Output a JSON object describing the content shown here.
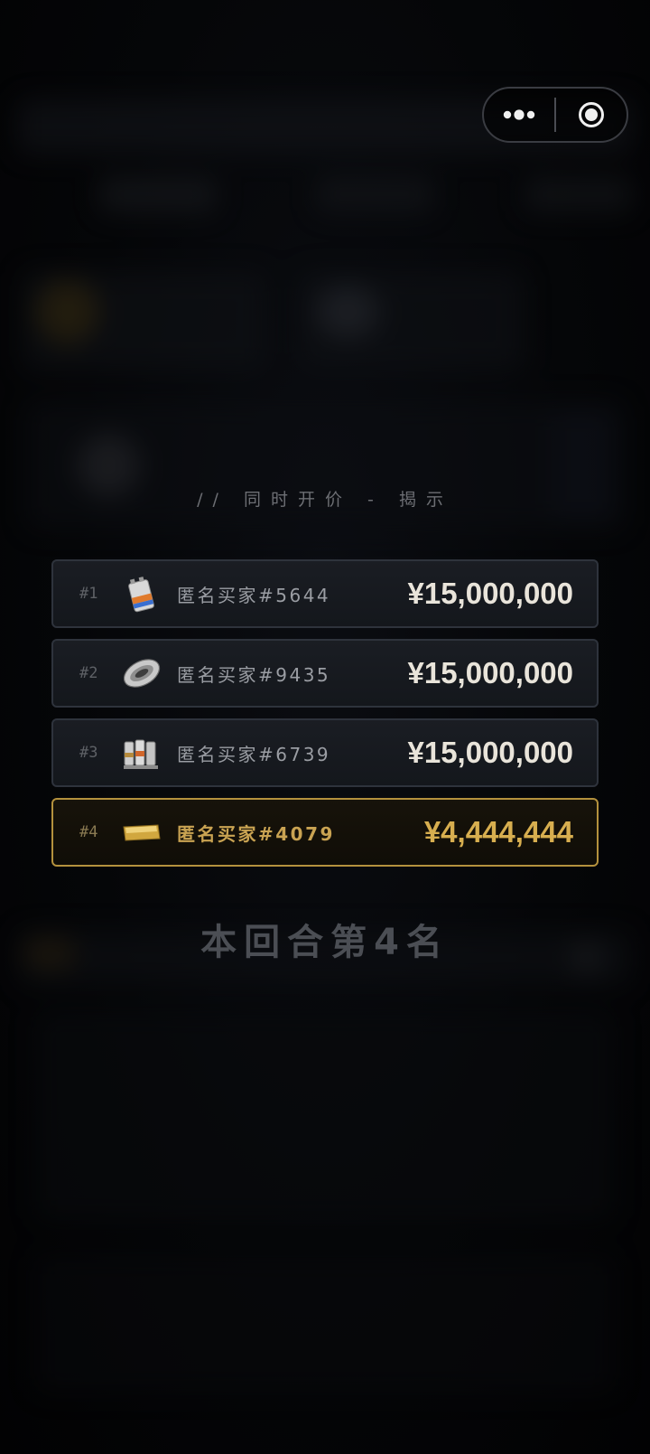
{
  "capsule": {
    "more_icon": "more-dots-icon",
    "close_icon": "target-circle-icon"
  },
  "reveal": {
    "title": "// 同时开价 - 揭示",
    "rows": [
      {
        "rank": "#1",
        "icon": "battery-icon",
        "buyer": "匿名买家#5644",
        "price": "¥15,000,000",
        "highlight": false
      },
      {
        "rank": "#2",
        "icon": "metal-plate-icon",
        "buyer": "匿名买家#9435",
        "price": "¥15,000,000",
        "highlight": false
      },
      {
        "rank": "#3",
        "icon": "canisters-icon",
        "buyer": "匿名买家#6739",
        "price": "¥15,000,000",
        "highlight": false
      },
      {
        "rank": "#4",
        "icon": "gold-bar-icon",
        "buyer": "匿名买家#4079",
        "price": "¥4,444,444",
        "highlight": true
      }
    ]
  },
  "result": {
    "text": "本回合第4名"
  },
  "colors": {
    "accent_gold": "#d7ae4f",
    "row_border": "#2e333c",
    "highlight_border": "#b4913d"
  }
}
